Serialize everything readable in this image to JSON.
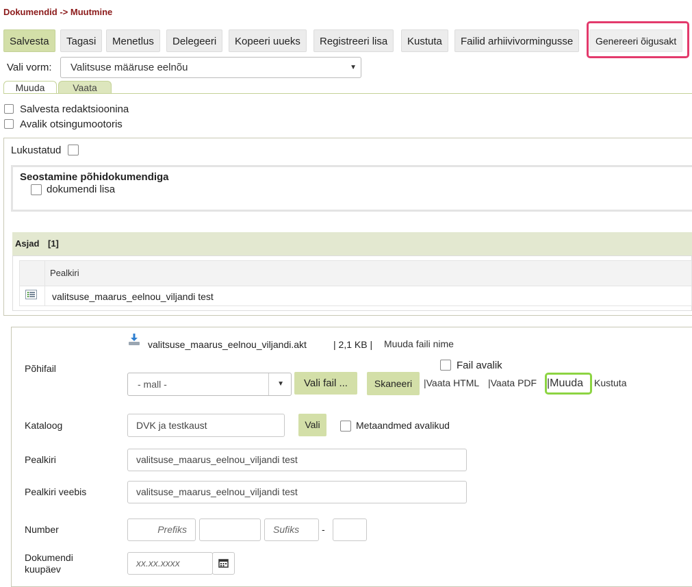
{
  "breadcrumb": "Dokumendid -> Muutmine",
  "toolbar": {
    "salvesta": "Salvesta",
    "tagasi": "Tagasi",
    "menetlus": "Menetlus",
    "delegeeri": "Delegeeri",
    "kopeeri": "Kopeeri uueks",
    "registreeri": "Registreeri lisa",
    "kustuta": "Kustuta",
    "failid": "Failid arhiivivormingusse",
    "genereeri": "Genereeri õigusakt"
  },
  "form_select": {
    "label": "Vali vorm:",
    "value": "Valitsuse määruse eelnõu"
  },
  "tabs": {
    "muuda": "Muuda",
    "vaata": "Vaata"
  },
  "options": {
    "redaktsioon": "Salvesta redaktsioonina",
    "avalik": "Avalik otsingumootoris"
  },
  "lukustatud": "Lukustatud",
  "seostamine": {
    "title": "Seostamine põhidokumendiga",
    "lisa": "dokumendi lisa"
  },
  "asjad": {
    "title": "Asjad",
    "count": "[1]",
    "header": "Pealkiri",
    "row": "valitsuse_maarus_eelnou_viljandi test"
  },
  "pohifail": {
    "label": "Põhifail",
    "filename": "valitsuse_maarus_eelnou_viljandi.akt",
    "size": "| 2,1 KB |",
    "rename": "Muuda faili nime",
    "fail_avalik": "Fail avalik",
    "mall": "- mall -",
    "vali_fail": "Vali fail ...",
    "skaneeri": "Skaneeri",
    "vaata_html": "|Vaata HTML",
    "vaata_pdf": "|Vaata PDF",
    "muuda": "|Muuda",
    "kustuta": "Kustuta"
  },
  "kataloog": {
    "label": "Kataloog",
    "value": "DVK ja testkaust",
    "vali": "Vali",
    "meta": "Metaandmed avalikud"
  },
  "pealkiri": {
    "label": "Pealkiri",
    "value": "valitsuse_maarus_eelnou_viljandi test"
  },
  "pealkiri_veebis": {
    "label": "Pealkiri veebis",
    "value": "valitsuse_maarus_eelnou_viljandi test"
  },
  "number": {
    "label": "Number",
    "prefiks": "Prefiks",
    "sufiks": "Sufiks",
    "dash": "-"
  },
  "kuupaev": {
    "label1": "Dokumendi",
    "label2": "kuupäev",
    "placeholder": "xx.xx.xxxx"
  }
}
